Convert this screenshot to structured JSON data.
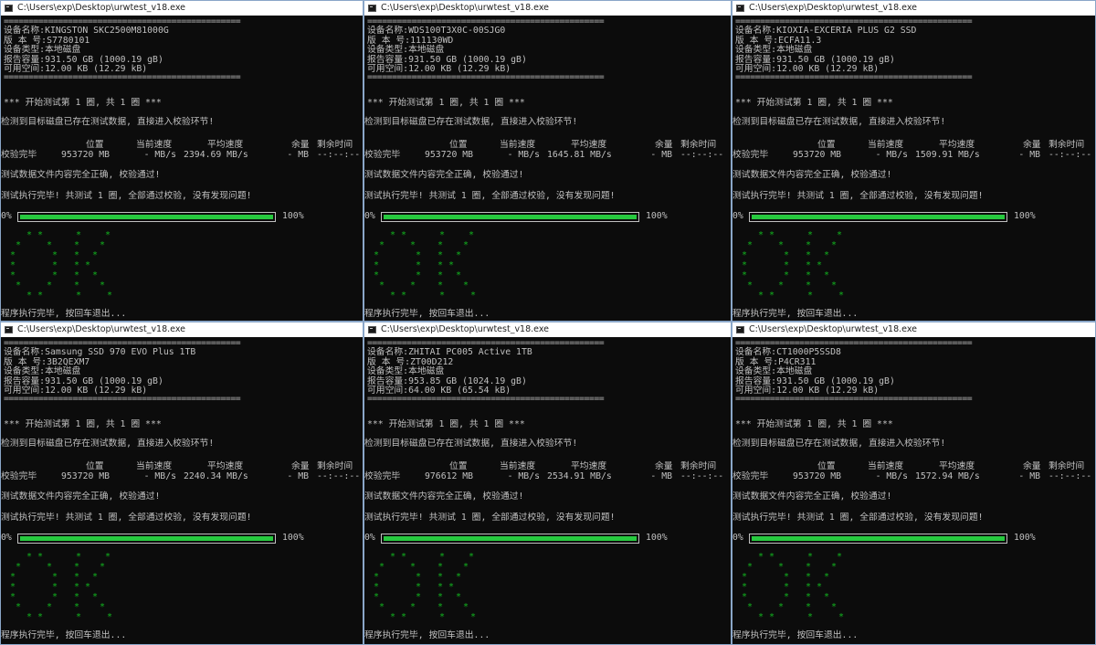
{
  "window_title": "C:\\Users\\exp\\Desktop\\urwtest_v18.exe",
  "separator": "================================================",
  "labels": {
    "device_name": "设备名称:",
    "version": "版 本 号:",
    "device_type": "设备类型:",
    "reported_capacity": "报告容量:",
    "free_space": "可用空间:"
  },
  "start_test": "*** 开始测试第 1 圈, 共 1 圈 ***",
  "existing_data": "检测到目标磁盘已存在测试数据, 直接进入校验环节!",
  "headers": {
    "position": "位置",
    "current_speed": "当前速度",
    "avg_speed": "平均速度",
    "remaining": "余量",
    "time_left": "剩余时间"
  },
  "verify_done": "校验完毕",
  "verify_ok": "测试数据文件内容完全正确, 校验通过!",
  "test_done": "测试执行完毕! 共测试 1 圈, 全部通过校验, 没有发现问题!",
  "progress": {
    "start": "0%",
    "end": "100%",
    "value": 1.0
  },
  "exit_msg": "程序执行完毕, 按回车退出...",
  "ok_color": "#13b51f",
  "bar_color": "#27c93f",
  "panels": [
    {
      "device_name": "KINGSTON SKC2500M81000G",
      "version": "S7780101",
      "device_type": "本地磁盘",
      "capacity": "931.50 GB (1000.19 gB)",
      "free_space": "12.00 KB (12.29 kB)",
      "position": "953720 MB",
      "current_speed": "- MB/s",
      "avg_speed": "2394.69 MB/s",
      "remaining": "- MB",
      "time_left": "--:--:--"
    },
    {
      "device_name": "WDS100T3X0C-00SJG0",
      "version": "111130WD",
      "device_type": "本地磁盘",
      "capacity": "931.50 GB (1000.19 gB)",
      "free_space": "12.00 KB (12.29 kB)",
      "position": "953720 MB",
      "current_speed": "- MB/s",
      "avg_speed": "1645.81 MB/s",
      "remaining": "- MB",
      "time_left": "--:--:--"
    },
    {
      "device_name": "KIOXIA-EXCERIA PLUS G2 SSD",
      "version": "ECFA11.3",
      "device_type": "本地磁盘",
      "capacity": "931.50 GB (1000.19 gB)",
      "free_space": "12.00 KB (12.29 kB)",
      "position": "953720 MB",
      "current_speed": "- MB/s",
      "avg_speed": "1509.91 MB/s",
      "remaining": "- MB",
      "time_left": "--:--:--"
    },
    {
      "device_name": "Samsung SSD 970 EVO Plus 1TB",
      "version": "3B2QEXM7",
      "device_type": "本地磁盘",
      "capacity": "931.50 GB (1000.19 gB)",
      "free_space": "12.00 KB (12.29 kB)",
      "position": "953720 MB",
      "current_speed": "- MB/s",
      "avg_speed": "2240.34 MB/s",
      "remaining": "- MB",
      "time_left": "--:--:--"
    },
    {
      "device_name": "ZHITAI PC005 Active 1TB",
      "version": "ZT00D212",
      "device_type": "本地磁盘",
      "capacity": "953.85 GB (1024.19 gB)",
      "free_space": "64.00 KB (65.54 kB)",
      "position": "976612 MB",
      "current_speed": "- MB/s",
      "avg_speed": "2534.91 MB/s",
      "remaining": "- MB",
      "time_left": "--:--:--"
    },
    {
      "device_name": "CT1000P5SSD8",
      "version": "P4CR311",
      "device_type": "本地磁盘",
      "capacity": "931.50 GB (1000.19 gB)",
      "free_space": "12.00 KB (12.29 kB)",
      "position": "953720 MB",
      "current_speed": "- MB/s",
      "avg_speed": "1572.94 MB/s",
      "remaining": "- MB",
      "time_left": "--:--:--"
    }
  ]
}
